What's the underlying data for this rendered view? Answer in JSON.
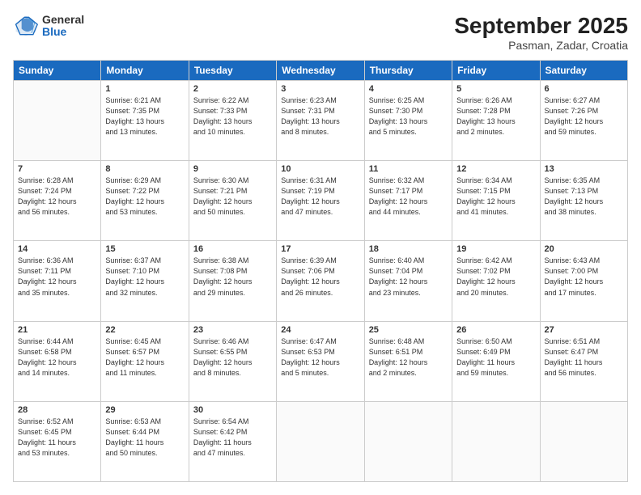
{
  "header": {
    "logo": {
      "general": "General",
      "blue": "Blue"
    },
    "title": "September 2025",
    "subtitle": "Pasman, Zadar, Croatia"
  },
  "weekdays": [
    "Sunday",
    "Monday",
    "Tuesday",
    "Wednesday",
    "Thursday",
    "Friday",
    "Saturday"
  ],
  "weeks": [
    [
      null,
      {
        "day": "1",
        "sunrise": "6:21 AM",
        "sunset": "7:35 PM",
        "daylight": "13 hours and 13 minutes."
      },
      {
        "day": "2",
        "sunrise": "6:22 AM",
        "sunset": "7:33 PM",
        "daylight": "13 hours and 10 minutes."
      },
      {
        "day": "3",
        "sunrise": "6:23 AM",
        "sunset": "7:31 PM",
        "daylight": "13 hours and 8 minutes."
      },
      {
        "day": "4",
        "sunrise": "6:25 AM",
        "sunset": "7:30 PM",
        "daylight": "13 hours and 5 minutes."
      },
      {
        "day": "5",
        "sunrise": "6:26 AM",
        "sunset": "7:28 PM",
        "daylight": "13 hours and 2 minutes."
      },
      {
        "day": "6",
        "sunrise": "6:27 AM",
        "sunset": "7:26 PM",
        "daylight": "12 hours and 59 minutes."
      }
    ],
    [
      {
        "day": "7",
        "sunrise": "6:28 AM",
        "sunset": "7:24 PM",
        "daylight": "12 hours and 56 minutes."
      },
      {
        "day": "8",
        "sunrise": "6:29 AM",
        "sunset": "7:22 PM",
        "daylight": "12 hours and 53 minutes."
      },
      {
        "day": "9",
        "sunrise": "6:30 AM",
        "sunset": "7:21 PM",
        "daylight": "12 hours and 50 minutes."
      },
      {
        "day": "10",
        "sunrise": "6:31 AM",
        "sunset": "7:19 PM",
        "daylight": "12 hours and 47 minutes."
      },
      {
        "day": "11",
        "sunrise": "6:32 AM",
        "sunset": "7:17 PM",
        "daylight": "12 hours and 44 minutes."
      },
      {
        "day": "12",
        "sunrise": "6:34 AM",
        "sunset": "7:15 PM",
        "daylight": "12 hours and 41 minutes."
      },
      {
        "day": "13",
        "sunrise": "6:35 AM",
        "sunset": "7:13 PM",
        "daylight": "12 hours and 38 minutes."
      }
    ],
    [
      {
        "day": "14",
        "sunrise": "6:36 AM",
        "sunset": "7:11 PM",
        "daylight": "12 hours and 35 minutes."
      },
      {
        "day": "15",
        "sunrise": "6:37 AM",
        "sunset": "7:10 PM",
        "daylight": "12 hours and 32 minutes."
      },
      {
        "day": "16",
        "sunrise": "6:38 AM",
        "sunset": "7:08 PM",
        "daylight": "12 hours and 29 minutes."
      },
      {
        "day": "17",
        "sunrise": "6:39 AM",
        "sunset": "7:06 PM",
        "daylight": "12 hours and 26 minutes."
      },
      {
        "day": "18",
        "sunrise": "6:40 AM",
        "sunset": "7:04 PM",
        "daylight": "12 hours and 23 minutes."
      },
      {
        "day": "19",
        "sunrise": "6:42 AM",
        "sunset": "7:02 PM",
        "daylight": "12 hours and 20 minutes."
      },
      {
        "day": "20",
        "sunrise": "6:43 AM",
        "sunset": "7:00 PM",
        "daylight": "12 hours and 17 minutes."
      }
    ],
    [
      {
        "day": "21",
        "sunrise": "6:44 AM",
        "sunset": "6:58 PM",
        "daylight": "12 hours and 14 minutes."
      },
      {
        "day": "22",
        "sunrise": "6:45 AM",
        "sunset": "6:57 PM",
        "daylight": "12 hours and 11 minutes."
      },
      {
        "day": "23",
        "sunrise": "6:46 AM",
        "sunset": "6:55 PM",
        "daylight": "12 hours and 8 minutes."
      },
      {
        "day": "24",
        "sunrise": "6:47 AM",
        "sunset": "6:53 PM",
        "daylight": "12 hours and 5 minutes."
      },
      {
        "day": "25",
        "sunrise": "6:48 AM",
        "sunset": "6:51 PM",
        "daylight": "12 hours and 2 minutes."
      },
      {
        "day": "26",
        "sunrise": "6:50 AM",
        "sunset": "6:49 PM",
        "daylight": "11 hours and 59 minutes."
      },
      {
        "day": "27",
        "sunrise": "6:51 AM",
        "sunset": "6:47 PM",
        "daylight": "11 hours and 56 minutes."
      }
    ],
    [
      {
        "day": "28",
        "sunrise": "6:52 AM",
        "sunset": "6:45 PM",
        "daylight": "11 hours and 53 minutes."
      },
      {
        "day": "29",
        "sunrise": "6:53 AM",
        "sunset": "6:44 PM",
        "daylight": "11 hours and 50 minutes."
      },
      {
        "day": "30",
        "sunrise": "6:54 AM",
        "sunset": "6:42 PM",
        "daylight": "11 hours and 47 minutes."
      },
      null,
      null,
      null,
      null
    ]
  ]
}
